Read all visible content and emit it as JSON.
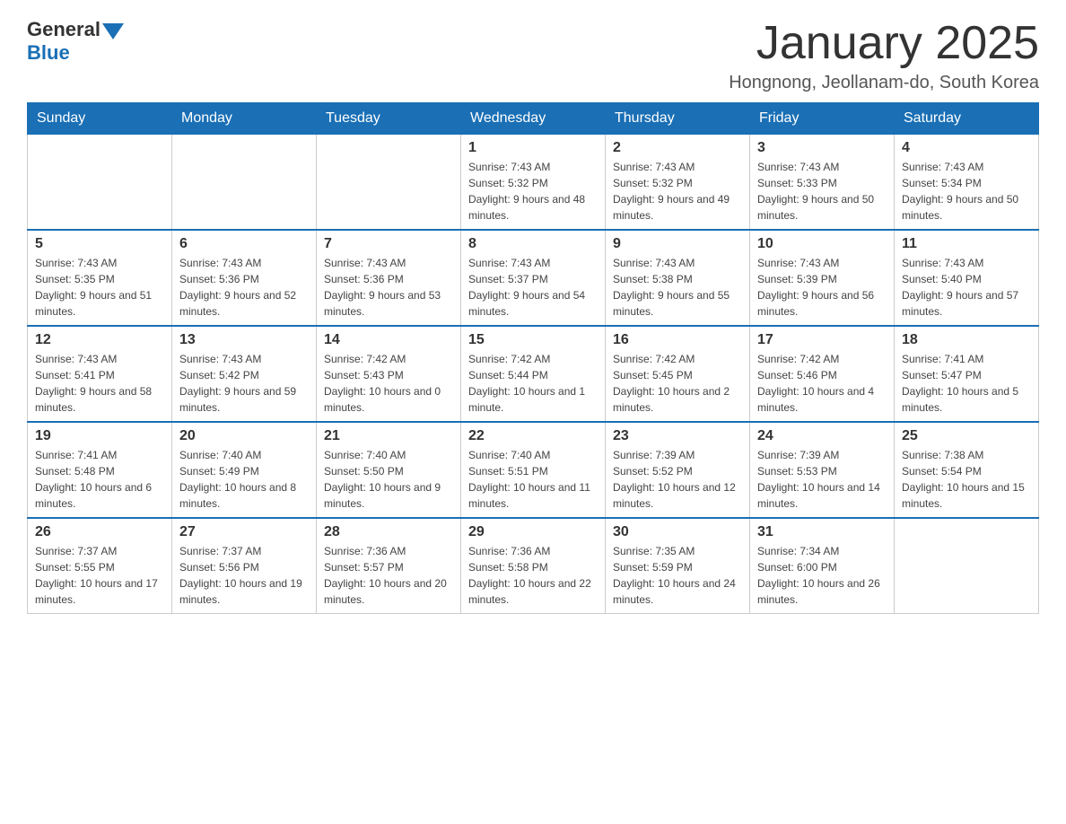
{
  "header": {
    "logo_general": "General",
    "logo_blue": "Blue",
    "title": "January 2025",
    "subtitle": "Hongnong, Jeollanam-do, South Korea"
  },
  "weekdays": [
    "Sunday",
    "Monday",
    "Tuesday",
    "Wednesday",
    "Thursday",
    "Friday",
    "Saturday"
  ],
  "weeks": [
    [
      {
        "day": "",
        "info": ""
      },
      {
        "day": "",
        "info": ""
      },
      {
        "day": "",
        "info": ""
      },
      {
        "day": "1",
        "info": "Sunrise: 7:43 AM\nSunset: 5:32 PM\nDaylight: 9 hours and 48 minutes."
      },
      {
        "day": "2",
        "info": "Sunrise: 7:43 AM\nSunset: 5:32 PM\nDaylight: 9 hours and 49 minutes."
      },
      {
        "day": "3",
        "info": "Sunrise: 7:43 AM\nSunset: 5:33 PM\nDaylight: 9 hours and 50 minutes."
      },
      {
        "day": "4",
        "info": "Sunrise: 7:43 AM\nSunset: 5:34 PM\nDaylight: 9 hours and 50 minutes."
      }
    ],
    [
      {
        "day": "5",
        "info": "Sunrise: 7:43 AM\nSunset: 5:35 PM\nDaylight: 9 hours and 51 minutes."
      },
      {
        "day": "6",
        "info": "Sunrise: 7:43 AM\nSunset: 5:36 PM\nDaylight: 9 hours and 52 minutes."
      },
      {
        "day": "7",
        "info": "Sunrise: 7:43 AM\nSunset: 5:36 PM\nDaylight: 9 hours and 53 minutes."
      },
      {
        "day": "8",
        "info": "Sunrise: 7:43 AM\nSunset: 5:37 PM\nDaylight: 9 hours and 54 minutes."
      },
      {
        "day": "9",
        "info": "Sunrise: 7:43 AM\nSunset: 5:38 PM\nDaylight: 9 hours and 55 minutes."
      },
      {
        "day": "10",
        "info": "Sunrise: 7:43 AM\nSunset: 5:39 PM\nDaylight: 9 hours and 56 minutes."
      },
      {
        "day": "11",
        "info": "Sunrise: 7:43 AM\nSunset: 5:40 PM\nDaylight: 9 hours and 57 minutes."
      }
    ],
    [
      {
        "day": "12",
        "info": "Sunrise: 7:43 AM\nSunset: 5:41 PM\nDaylight: 9 hours and 58 minutes."
      },
      {
        "day": "13",
        "info": "Sunrise: 7:43 AM\nSunset: 5:42 PM\nDaylight: 9 hours and 59 minutes."
      },
      {
        "day": "14",
        "info": "Sunrise: 7:42 AM\nSunset: 5:43 PM\nDaylight: 10 hours and 0 minutes."
      },
      {
        "day": "15",
        "info": "Sunrise: 7:42 AM\nSunset: 5:44 PM\nDaylight: 10 hours and 1 minute."
      },
      {
        "day": "16",
        "info": "Sunrise: 7:42 AM\nSunset: 5:45 PM\nDaylight: 10 hours and 2 minutes."
      },
      {
        "day": "17",
        "info": "Sunrise: 7:42 AM\nSunset: 5:46 PM\nDaylight: 10 hours and 4 minutes."
      },
      {
        "day": "18",
        "info": "Sunrise: 7:41 AM\nSunset: 5:47 PM\nDaylight: 10 hours and 5 minutes."
      }
    ],
    [
      {
        "day": "19",
        "info": "Sunrise: 7:41 AM\nSunset: 5:48 PM\nDaylight: 10 hours and 6 minutes."
      },
      {
        "day": "20",
        "info": "Sunrise: 7:40 AM\nSunset: 5:49 PM\nDaylight: 10 hours and 8 minutes."
      },
      {
        "day": "21",
        "info": "Sunrise: 7:40 AM\nSunset: 5:50 PM\nDaylight: 10 hours and 9 minutes."
      },
      {
        "day": "22",
        "info": "Sunrise: 7:40 AM\nSunset: 5:51 PM\nDaylight: 10 hours and 11 minutes."
      },
      {
        "day": "23",
        "info": "Sunrise: 7:39 AM\nSunset: 5:52 PM\nDaylight: 10 hours and 12 minutes."
      },
      {
        "day": "24",
        "info": "Sunrise: 7:39 AM\nSunset: 5:53 PM\nDaylight: 10 hours and 14 minutes."
      },
      {
        "day": "25",
        "info": "Sunrise: 7:38 AM\nSunset: 5:54 PM\nDaylight: 10 hours and 15 minutes."
      }
    ],
    [
      {
        "day": "26",
        "info": "Sunrise: 7:37 AM\nSunset: 5:55 PM\nDaylight: 10 hours and 17 minutes."
      },
      {
        "day": "27",
        "info": "Sunrise: 7:37 AM\nSunset: 5:56 PM\nDaylight: 10 hours and 19 minutes."
      },
      {
        "day": "28",
        "info": "Sunrise: 7:36 AM\nSunset: 5:57 PM\nDaylight: 10 hours and 20 minutes."
      },
      {
        "day": "29",
        "info": "Sunrise: 7:36 AM\nSunset: 5:58 PM\nDaylight: 10 hours and 22 minutes."
      },
      {
        "day": "30",
        "info": "Sunrise: 7:35 AM\nSunset: 5:59 PM\nDaylight: 10 hours and 24 minutes."
      },
      {
        "day": "31",
        "info": "Sunrise: 7:34 AM\nSunset: 6:00 PM\nDaylight: 10 hours and 26 minutes."
      },
      {
        "day": "",
        "info": ""
      }
    ]
  ]
}
